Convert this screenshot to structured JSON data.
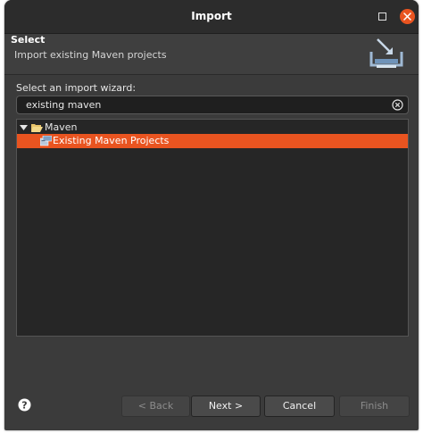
{
  "window": {
    "title": "Import"
  },
  "header": {
    "title": "Select",
    "description": "Import existing Maven projects"
  },
  "wizard": {
    "label": "Select an import wizard:",
    "search_value": "existing maven"
  },
  "tree": {
    "parent_label": "Maven",
    "child_label": "Existing Maven Projects"
  },
  "buttons": {
    "back": "< Back",
    "next": "Next >",
    "cancel": "Cancel",
    "finish": "Finish"
  },
  "colors": {
    "accent": "#e95420",
    "background": "#3b3b3b",
    "tree_background": "#262626"
  },
  "icons": {
    "maximize": "maximize-icon",
    "close": "close-icon",
    "header": "import-wizard-icon",
    "clear": "clear-search-icon",
    "twisty": "chevron-down-icon",
    "folder": "folder-open-icon",
    "project": "maven-project-icon",
    "help": "help-icon"
  }
}
